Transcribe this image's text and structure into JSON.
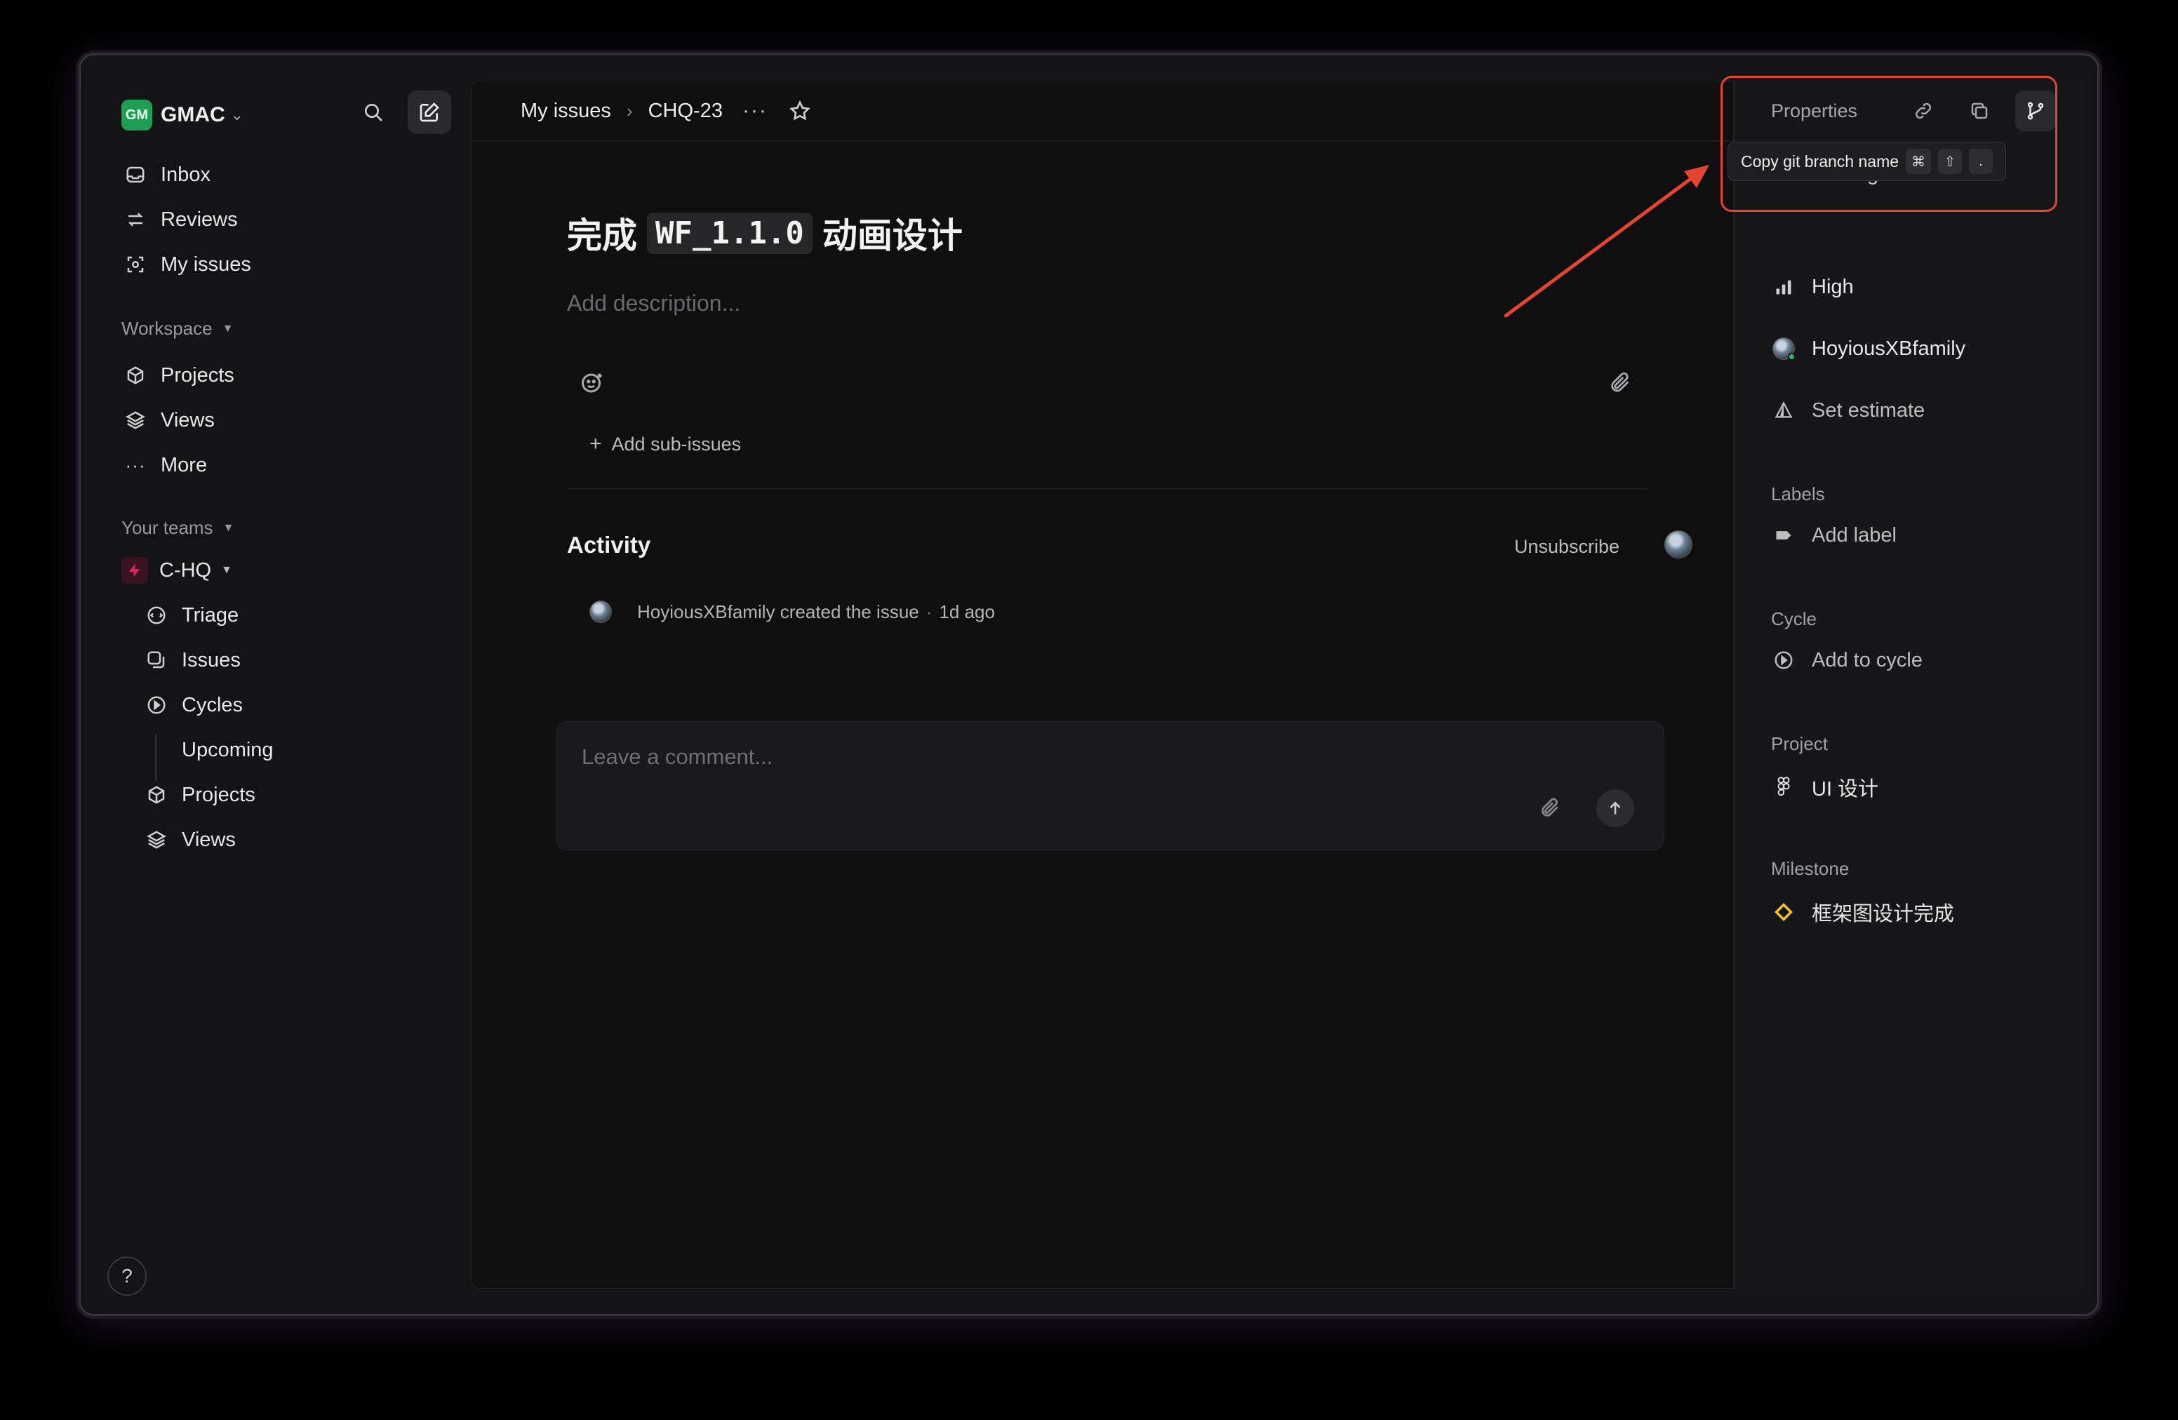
{
  "workspace": {
    "badge": "GM",
    "name": "GMAC"
  },
  "sidebar": {
    "top_items": [
      {
        "label": "Inbox",
        "icon": "inbox-icon"
      },
      {
        "label": "Reviews",
        "icon": "reviews-icon"
      },
      {
        "label": "My issues",
        "icon": "my-issues-icon"
      }
    ],
    "workspace_header": "Workspace",
    "workspace_items": [
      {
        "label": "Projects",
        "icon": "projects-icon"
      },
      {
        "label": "Views",
        "icon": "views-icon"
      },
      {
        "label": "More",
        "icon": "more-icon"
      }
    ],
    "teams_header": "Your teams",
    "team": {
      "name": "C-HQ",
      "icon": "team-bolt-icon",
      "color": "#e0245e"
    },
    "team_items": [
      {
        "label": "Triage",
        "icon": "triage-icon"
      },
      {
        "label": "Issues",
        "icon": "issues-icon"
      },
      {
        "label": "Cycles",
        "icon": "cycles-icon"
      },
      {
        "label": "Upcoming",
        "icon": ""
      },
      {
        "label": "Projects",
        "icon": "projects-icon"
      },
      {
        "label": "Views",
        "icon": "views-icon"
      }
    ],
    "help": "?"
  },
  "breadcrumb": {
    "parent": "My issues",
    "separator": "›",
    "current": "CHQ-23",
    "more": "···"
  },
  "issue": {
    "title_prefix": "完成",
    "title_code": "WF_1.1.0",
    "title_suffix": "动画设计",
    "description_placeholder": "Add description...",
    "add_sub_issues": "Add sub-issues"
  },
  "activity": {
    "heading": "Activity",
    "unsubscribe": "Unsubscribe",
    "entry_text": "HoyiousXBfamily created the issue",
    "entry_separator": "·",
    "entry_time": "1d ago",
    "comment_placeholder": "Leave a comment..."
  },
  "properties": {
    "heading": "Properties",
    "tooltip": {
      "text": "Copy git branch name",
      "keys": [
        "⌘",
        "⇧",
        "."
      ]
    },
    "status_partial": "Backlog",
    "priority": "High",
    "assignee": "HoyiousXBfamily",
    "estimate": "Set estimate",
    "labels_heading": "Labels",
    "labels_action": "Add label",
    "cycle_heading": "Cycle",
    "cycle_action": "Add to cycle",
    "project_heading": "Project",
    "project_value": "UI 设计",
    "milestone_heading": "Milestone",
    "milestone_value": "框架图设计完成"
  },
  "colors": {
    "accent_annotation": "#e54530",
    "workspace_badge": "#1e9e52",
    "milestone": "#f2c12e",
    "team": "#e0245e"
  }
}
